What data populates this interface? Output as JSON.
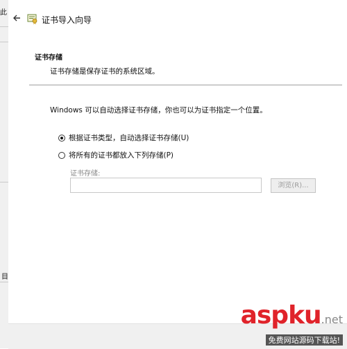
{
  "background": {
    "fragment_top": "此",
    "fragment_bottom": "目"
  },
  "dialog": {
    "title": "证书导入向导",
    "section_title": "证书存储",
    "section_desc": "证书存储是保存证书的系统区域。",
    "intro": "Windows 可以自动选择证书存储，你也可以为证书指定一个位置。",
    "options": [
      {
        "label": "根据证书类型，自动选择证书存储(U)",
        "checked": true
      },
      {
        "label": "将所有的证书都放入下列存储(P)",
        "checked": false
      }
    ],
    "store_label": "证书存储:",
    "store_value": "",
    "browse_label": "浏览(R)..."
  },
  "watermark": {
    "logo_asp": "asp",
    "logo_ku": "ku",
    "logo_net": ".net",
    "subtitle": "免费网站源码下载站!"
  },
  "colors": {
    "accent": "#e0232a",
    "footer_bg": "#f0f0f0",
    "separator": "#a0a0a0",
    "disabled_text": "#9a9a9a"
  }
}
